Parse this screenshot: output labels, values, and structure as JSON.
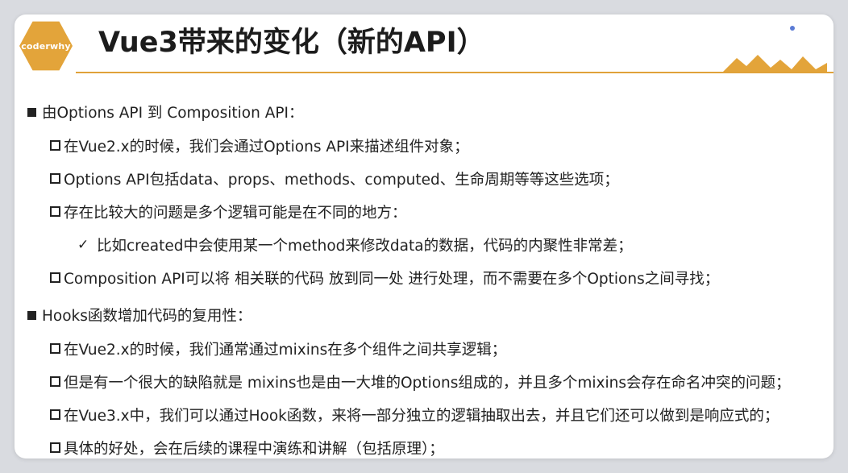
{
  "slide": {
    "logo_text": "coderwhy",
    "title": "Vue3带来的变化（新的API）",
    "accent_color": "#e0a23a",
    "logo_color": "#e3a43a"
  },
  "sections": [
    {
      "heading": "由Options API 到 Composition API：",
      "items": [
        "在Vue2.x的时候，我们会通过Options API来描述组件对象；",
        "Options API包括data、props、methods、computed、生命周期等等这些选项；",
        "存在比较大的问题是多个逻辑可能是在不同的地方：",
        "比如created中会使用某一个method来修改data的数据，代码的内聚性非常差；",
        "Composition API可以将 相关联的代码 放到同一处 进行处理，而不需要在多个Options之间寻找；"
      ]
    },
    {
      "heading": "Hooks函数增加代码的复用性：",
      "items": [
        "在Vue2.x的时候，我们通常通过mixins在多个组件之间共享逻辑；",
        "但是有一个很大的缺陷就是 mixins也是由一大堆的Options组成的，并且多个mixins会存在命名冲突的问题；",
        "在Vue3.x中，我们可以通过Hook函数，来将一部分独立的逻辑抽取出去，并且它们还可以做到是响应式的；",
        "具体的好处，会在后续的课程中演练和讲解（包括原理）；"
      ]
    }
  ]
}
